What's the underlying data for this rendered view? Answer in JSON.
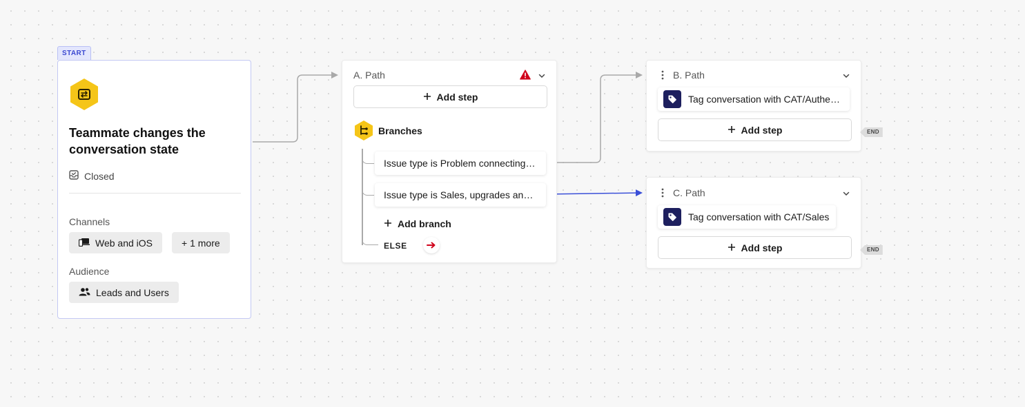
{
  "start": {
    "tag": "START",
    "title": "Teammate changes the conversation state",
    "state": "Closed",
    "channels_label": "Channels",
    "channels": [
      "Web and iOS",
      "+ 1 more"
    ],
    "audience_label": "Audience",
    "audience": "Leads and Users"
  },
  "path_a": {
    "title": "A. Path",
    "add_step": "Add step",
    "branches_label": "Branches",
    "branches": [
      "Issue type is Problem connecting to the internet",
      "Issue type is Sales, upgrades and billing"
    ],
    "add_branch": "Add branch",
    "else_label": "ELSE"
  },
  "path_b": {
    "title": "B. Path",
    "step_action": "Tag conversation",
    "step_detail": " with CAT/Authentication",
    "add_step": "Add step",
    "end": "END"
  },
  "path_c": {
    "title": "C. Path",
    "step_action": "Tag conversation",
    "step_detail": " with CAT/Sales",
    "add_step": "Add step",
    "end": "END"
  },
  "colors": {
    "accent_yellow": "#f5c518",
    "link_blue": "#3a4fd8",
    "warning_red": "#d0021b",
    "tag_navy": "#1d1f5e"
  }
}
